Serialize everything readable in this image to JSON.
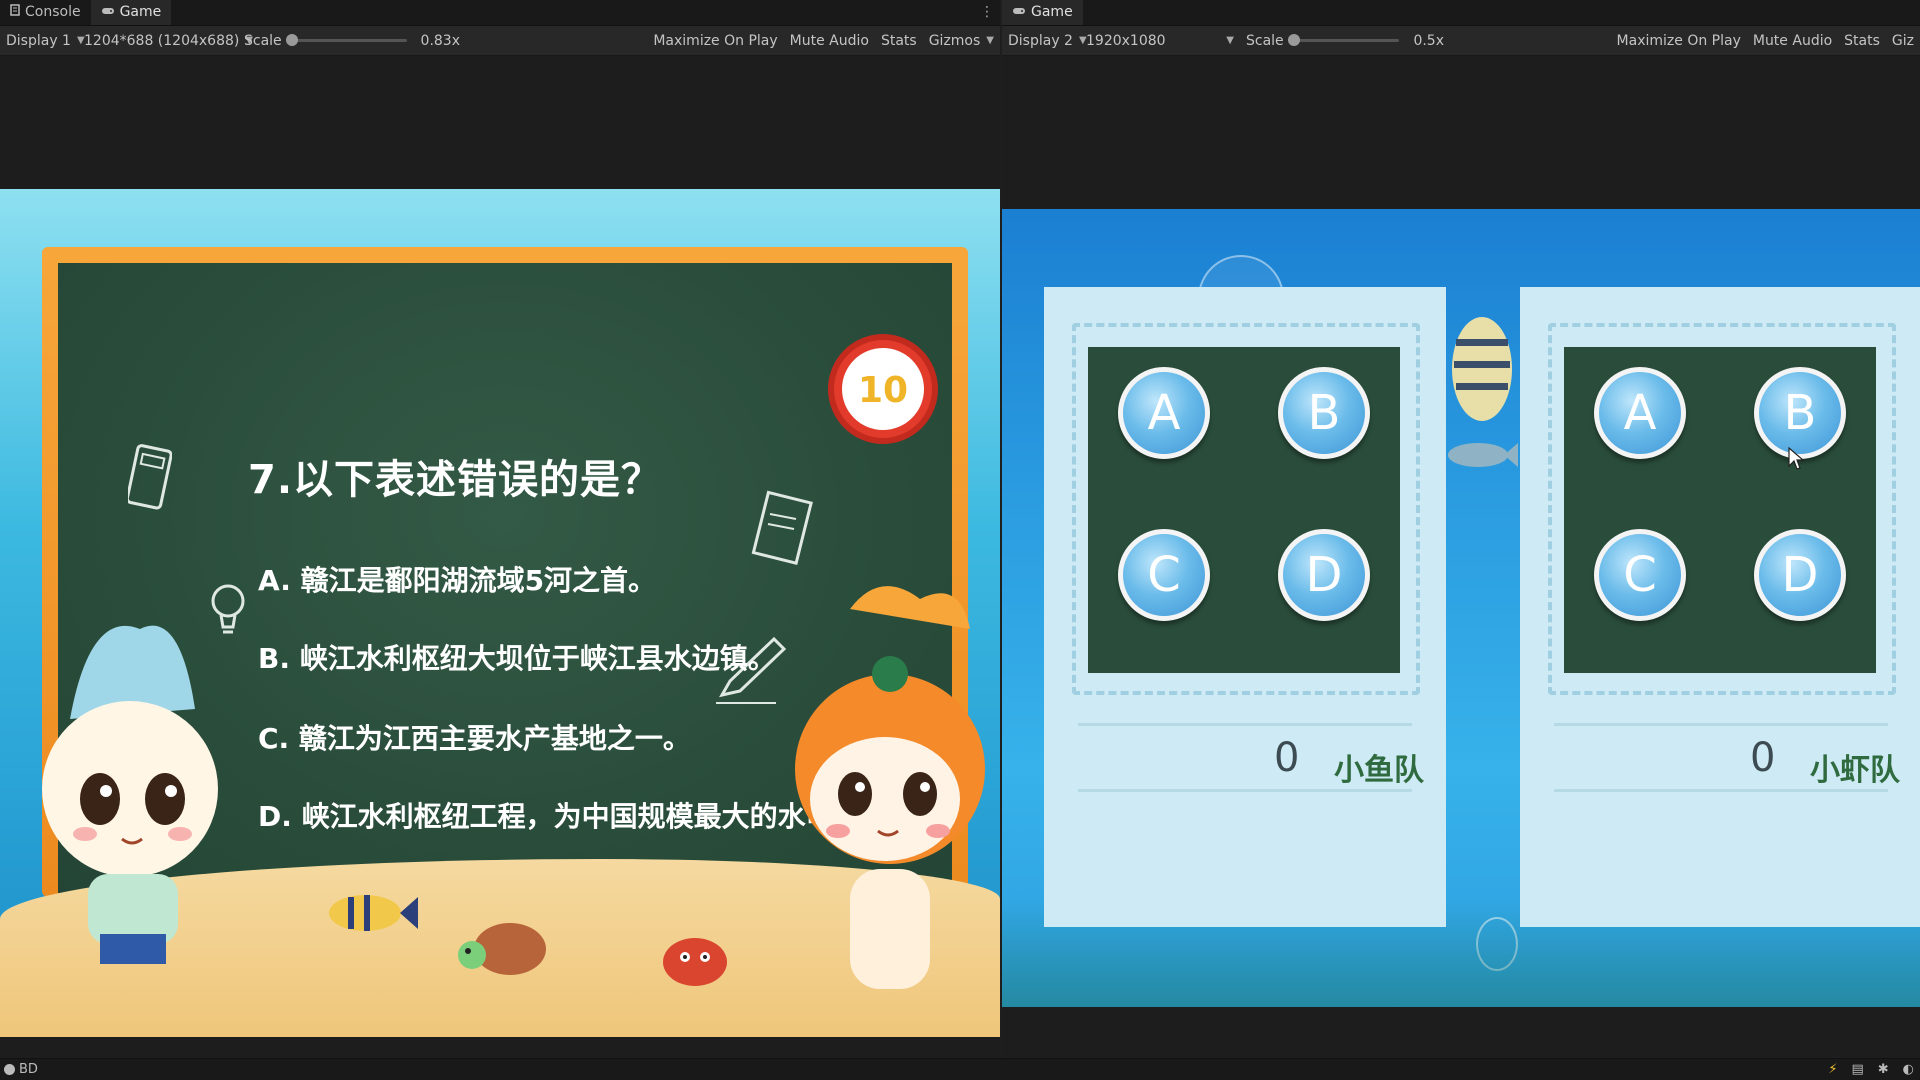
{
  "left_window": {
    "tabs": [
      {
        "label": "Console",
        "icon": "console-icon"
      },
      {
        "label": "Game",
        "icon": "gamepad-icon"
      }
    ],
    "toolbar": {
      "display": "Display 1",
      "resolution": "1204*688 (1204x688)",
      "scale_label": "Scale",
      "scale_value": "0.83x",
      "scale_level": 0.0,
      "maximize": "Maximize On Play",
      "mute": "Mute Audio",
      "stats": "Stats",
      "gizmos": "Gizmos"
    }
  },
  "right_window": {
    "tabs": [
      {
        "label": "Game",
        "icon": "gamepad-icon"
      }
    ],
    "toolbar": {
      "display": "Display 2",
      "resolution": "1920x1080",
      "scale_label": "Scale",
      "scale_value": "0.5x",
      "scale_level": 0.0,
      "maximize": "Maximize On Play",
      "mute": "Mute Audio",
      "stats": "Stats",
      "gizmos": "Giz"
    }
  },
  "quiz": {
    "question": "7.以下表述错误的是？",
    "options": [
      "A. 赣江是鄱阳湖流域5河之首。",
      "B. 峡江水利枢纽大坝位于峡江县水边镇。",
      "C. 赣江为江西主要水产基地之一。",
      "D. 峡江水利枢纽工程，为中国规模最大的水电站之一"
    ],
    "timer": "10"
  },
  "teams": [
    {
      "buttons": [
        "A",
        "B",
        "C",
        "D"
      ],
      "score": "0",
      "name": "小鱼队"
    },
    {
      "buttons": [
        "A",
        "B",
        "C",
        "D"
      ],
      "score": "0",
      "name": "小虾队"
    }
  ],
  "status": {
    "text": "BD"
  },
  "colors": {
    "editor_bg": "#1e1e1e",
    "board": "#2a4d3b",
    "board_frame": "#ec8a1f",
    "answer_button": "#6bbcea",
    "panel": "#cdeaf5",
    "team_text": "#2f6b3e"
  }
}
